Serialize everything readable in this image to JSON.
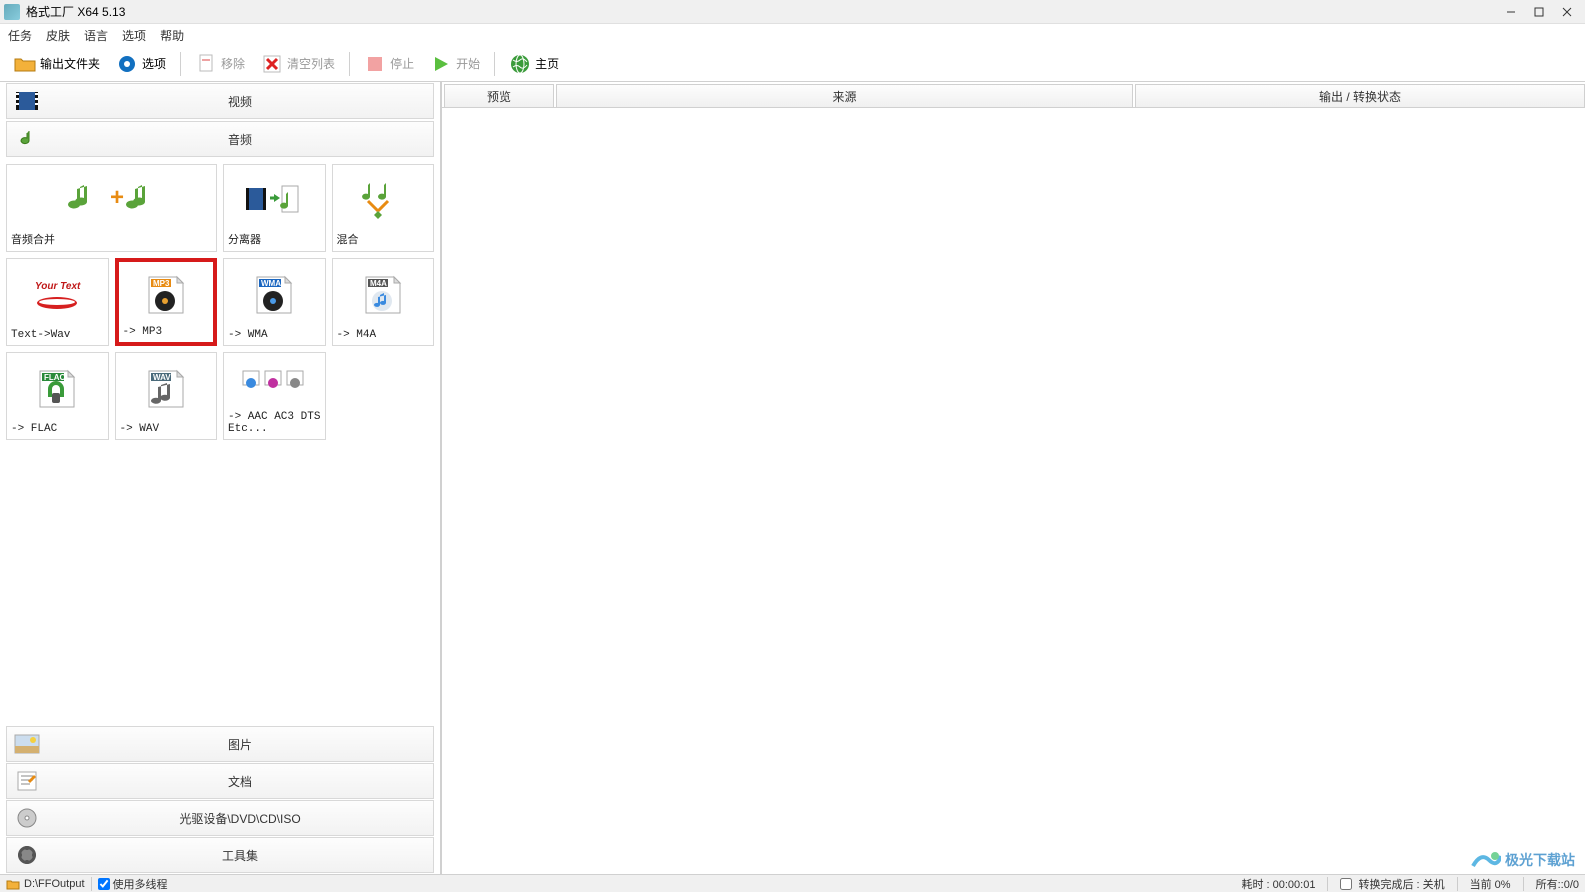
{
  "window": {
    "title": "格式工厂 X64 5.13"
  },
  "menu": {
    "task": "任务",
    "skin": "皮肤",
    "lang": "语言",
    "options": "选项",
    "help": "帮助"
  },
  "toolbar": {
    "output_folder": "输出文件夹",
    "options": "选项",
    "remove": "移除",
    "clear_list": "清空列表",
    "stop": "停止",
    "start": "开始",
    "home": "主页"
  },
  "categories": {
    "video": "视频",
    "audio": "音频",
    "image": "图片",
    "doc": "文档",
    "disc": "光驱设备\\DVD\\CD\\ISO",
    "tools": "工具集"
  },
  "tiles": {
    "audio_merge": "音频合并",
    "splitter": "分离器",
    "mix": "混合",
    "text_wav": "Text->Wav",
    "mp3": "-> MP3",
    "wma": "-> WMA",
    "m4a": "-> M4A",
    "flac": "-> FLAC",
    "wav": "-> WAV",
    "aac_etc": "-> AAC AC3 DTS Etc..."
  },
  "columns": {
    "preview": "预览",
    "source": "来源",
    "output": "输出 / 转换状态"
  },
  "status": {
    "output_path": "D:\\FFOutput",
    "multithread": "使用多线程",
    "elapsed": "耗时 : 00:00:01",
    "after_done": "转换完成后 : 关机",
    "current": "当前 0%",
    "all": "所有::0/0"
  },
  "watermark": "极光下载站",
  "chk": {
    "multithread": true,
    "shutdown": false
  }
}
